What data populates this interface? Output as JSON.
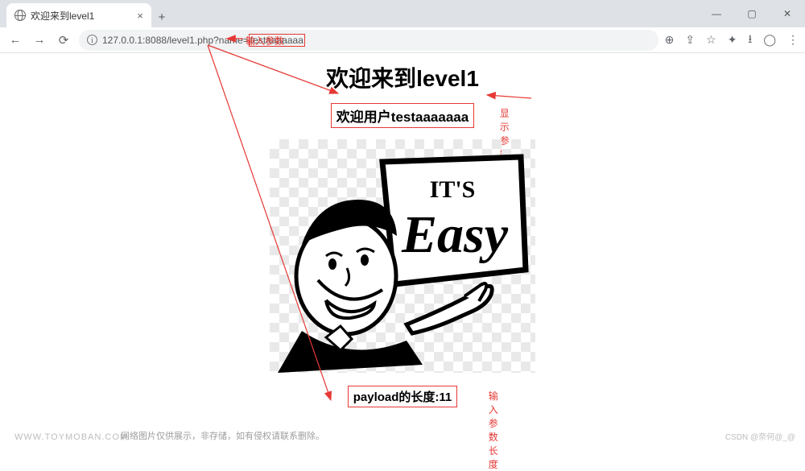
{
  "browser": {
    "tab_title": "欢迎来到level1",
    "url_host": "127.0.0.1:8088/level1.php?name=",
    "url_param": "testaaaaaaa",
    "window": {
      "min": "—",
      "max": "▢",
      "close": "✕"
    }
  },
  "annotations": {
    "input_param": "输入参数",
    "show_param": "显示参数",
    "input_param_len": "输入参数长度"
  },
  "page": {
    "h1": "欢迎来到level1",
    "welcome": "欢迎用户testaaaaaaa",
    "payload": "payload的长度:11",
    "illus": {
      "top": "IT'S",
      "main": "Easy"
    }
  },
  "footer": {
    "site": "WWW.TOYMOBAN.COM",
    "disclaimer": "网络图片仅供展示，非存储，如有侵权请联系删除。",
    "credit": "CSDN @奈何@_@"
  },
  "colors": {
    "accent": "#e53935"
  }
}
